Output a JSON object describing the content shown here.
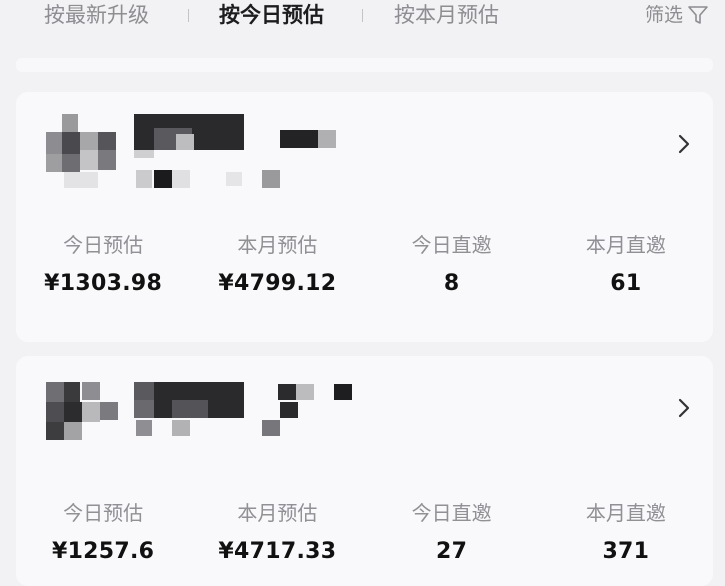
{
  "top_bar": {
    "tabs": [
      {
        "label": "按最新升级"
      },
      {
        "label": "按今日预估"
      },
      {
        "label": "按本月预估"
      }
    ],
    "filter_label": "筛选",
    "filter_icon": "funnel-icon",
    "active_tab_index": 1
  },
  "cards": [
    {
      "name_redacted": true,
      "chevron_icon": "chevron-right-icon",
      "stats": [
        {
          "label": "今日预估",
          "value": "¥1303.98"
        },
        {
          "label": "本月预估",
          "value": "¥4799.12"
        },
        {
          "label": "今日直邀",
          "value": "8"
        },
        {
          "label": "本月直邀",
          "value": "61"
        }
      ]
    },
    {
      "name_redacted": true,
      "chevron_icon": "chevron-right-icon",
      "stats": [
        {
          "label": "今日预估",
          "value": "¥1257.6"
        },
        {
          "label": "本月预估",
          "value": "¥4717.33"
        },
        {
          "label": "今日直邀",
          "value": "27"
        },
        {
          "label": "本月直邀",
          "value": "371"
        }
      ]
    }
  ],
  "colors": {
    "background": "#f2f2f4",
    "card": "#f9f9fb",
    "muted_text": "#8d8d92",
    "active_text": "#1d1d1f"
  }
}
